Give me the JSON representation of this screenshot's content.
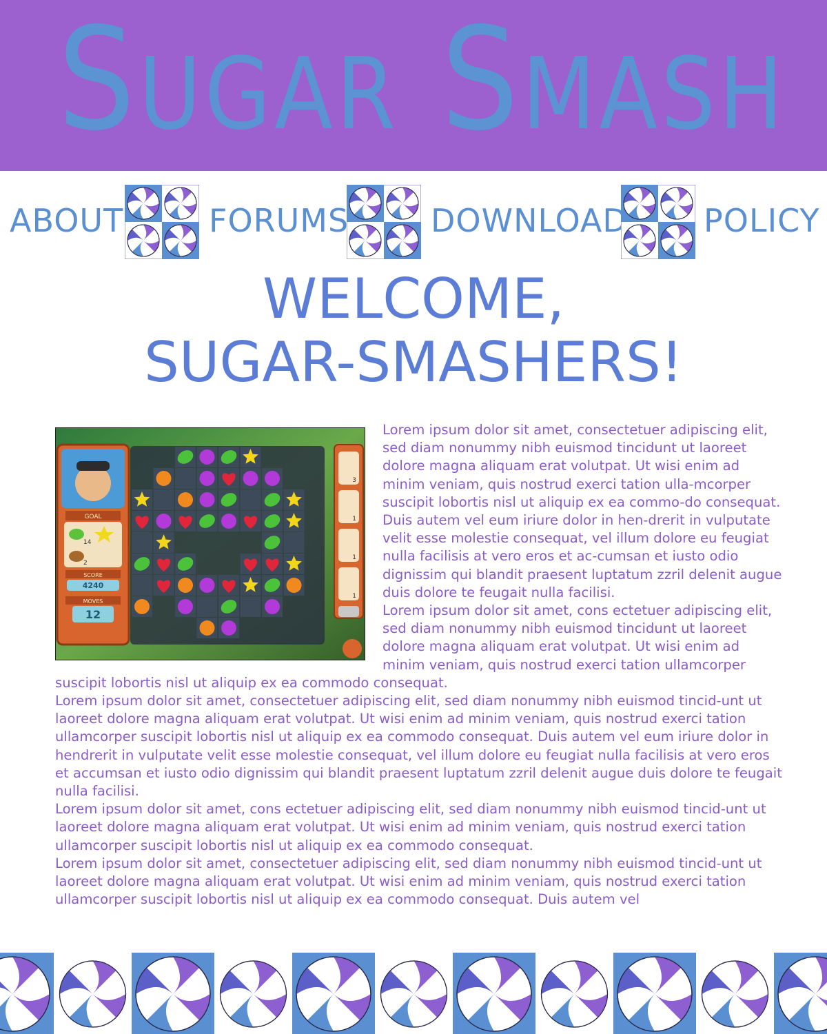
{
  "site": {
    "title": "Sugar Smash",
    "colors": {
      "banner": "#9d60cf",
      "title": "#5b93d3",
      "nav": "#5a8fd2",
      "heading": "#5b7dd6",
      "body_text": "#8b5cc8",
      "candy_blue": "#5a8fd2",
      "candy_purple": "#8e5fd0",
      "candy_indigo": "#5b5fc7"
    }
  },
  "nav": {
    "items": [
      {
        "label": "ABOUT"
      },
      {
        "label": "FORUMS"
      },
      {
        "label": "DOWNLOAD"
      },
      {
        "label": "POLICY"
      }
    ],
    "separator_icon": "peppermint-candy-tile-icon"
  },
  "welcome": {
    "line1": "WELCOME,",
    "line2": "SUGAR-SMASHERS!"
  },
  "game_screenshot": {
    "icon": "match-three-game-board-image",
    "goal_label": "GOAL",
    "goal_leaf_count": "14",
    "goal_nut_count": "2",
    "score_label": "SCORE",
    "score_value": "4240",
    "moves_label": "MOVES",
    "moves_value": "12",
    "side_counts": [
      "3",
      "1",
      "1",
      "1"
    ]
  },
  "body": {
    "paragraphs": [
      "Lorem ipsum dolor sit amet, consectetuer adipiscing elit, sed diam nonummy nibh euismod tincidunt ut laoreet dolore magna aliquam erat volutpat. Ut wisi enim ad minim veniam, quis nostrud exerci tation ulla-mcorper suscipit lobortis nisl ut aliquip ex ea commo-do consequat. Duis autem vel eum iriure dolor in hen-drerit in vulputate velit esse molestie consequat, vel illum dolore eu feugiat nulla facilisis at vero eros et ac-cumsan et iusto odio dignissim qui blandit praesent luptatum zzril delenit augue duis dolore te feugait nulla facilisi.",
      "Lorem ipsum dolor sit amet, cons ectetuer adipiscing elit, sed diam nonummy nibh euismod tincidunt ut laoreet dolore magna aliquam erat volutpat. Ut wisi enim ad minim veniam, quis nostrud exerci tation ullamcorper suscipit lobortis nisl ut aliquip ex ea commodo consequat.",
      "Lorem ipsum dolor sit amet, consectetuer adipiscing elit, sed diam nonummy nibh euismod tincid-unt ut laoreet dolore magna aliquam erat volutpat. Ut wisi enim ad minim veniam, quis nostrud exerci tation ullamcorper suscipit lobortis nisl ut aliquip ex ea commodo consequat. Duis autem vel eum iriure dolor in hendrerit in vulputate velit esse molestie consequat, vel illum dolore eu feugiat nulla facilisis at vero eros et accumsan et iusto odio dignissim qui blandit praesent luptatum zzril delenit augue duis dolore te feugait nulla facilisi.",
      "Lorem ipsum dolor sit amet, cons ectetuer adipiscing elit, sed diam nonummy nibh euismod tincid-unt ut laoreet dolore magna aliquam erat volutpat. Ut wisi enim ad minim veniam, quis nostrud exerci tation ullamcorper suscipit lobortis nisl ut aliquip ex ea commodo consequat.",
      "Lorem ipsum dolor sit amet, consectetuer adipiscing elit, sed diam nonummy nibh euismod tincid-unt ut laoreet dolore magna aliquam erat volutpat. Ut wisi enim ad minim veniam, quis nostrud exerci tation ullamcorper suscipit lobortis nisl ut aliquip ex ea commodo consequat. Duis autem vel"
    ]
  },
  "footer": {
    "icon": "peppermint-candy-border-icon"
  }
}
